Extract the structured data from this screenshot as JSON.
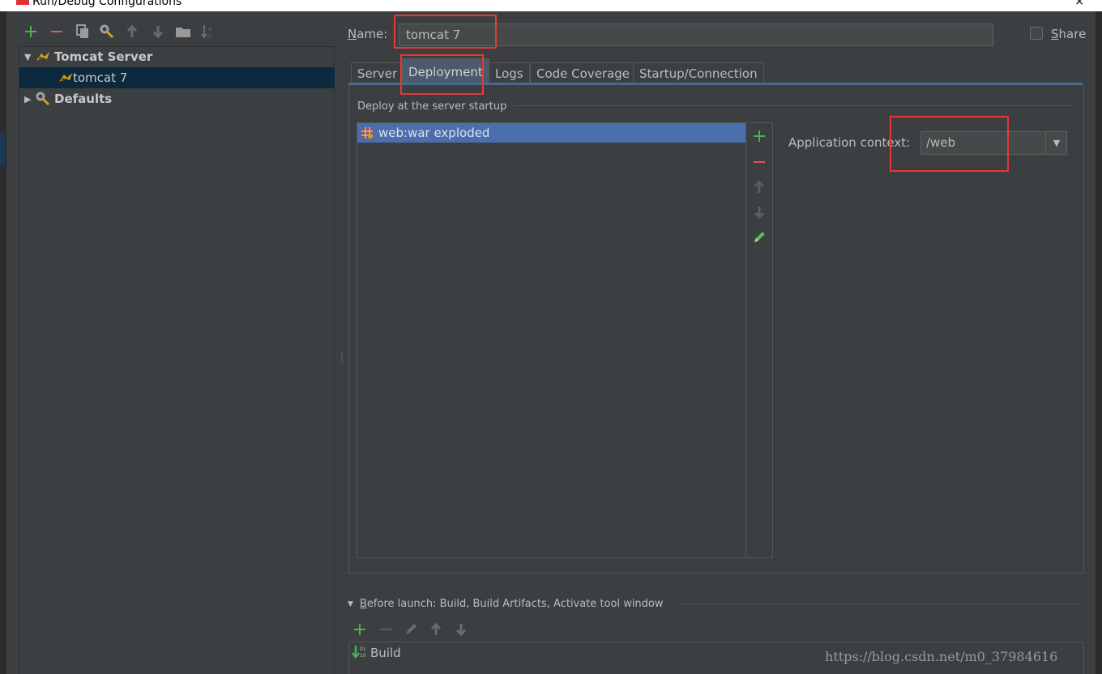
{
  "window": {
    "title": "Run/Debug Configurations",
    "close_glyph": "×"
  },
  "toolbar": {
    "icons": [
      "plus-icon",
      "minus-icon",
      "copy-icon",
      "wrench-icon",
      "arrow-up-icon",
      "arrow-down-icon",
      "folder-icon",
      "sort-icon"
    ]
  },
  "tree": {
    "group": {
      "label": "Tomcat Server",
      "expanded": true,
      "icon": "tomcat-icon"
    },
    "child": {
      "label": "tomcat 7",
      "selected": true,
      "icon": "tomcat-icon"
    },
    "defaults": {
      "label": "Defaults",
      "expanded": false,
      "icon": "wrench-icon"
    }
  },
  "form": {
    "name_label_prefix": "N",
    "name_label_rest": "ame:",
    "name_value": "tomcat 7",
    "share_label_prefix": "S",
    "share_label_rest": "hare",
    "share_checked": false
  },
  "tabs": [
    {
      "label": "Server",
      "active": false
    },
    {
      "label": "Deployment",
      "active": true
    },
    {
      "label": "Logs",
      "active": false
    },
    {
      "label": "Code Coverage",
      "active": false
    },
    {
      "label": "Startup/Connection",
      "active": false
    }
  ],
  "deployment": {
    "section_title": "Deploy at the server startup",
    "artifacts": [
      {
        "label": "web:war exploded",
        "selected": true,
        "icon": "artifact-icon"
      }
    ],
    "list_tools": [
      "plus-icon",
      "minus-icon",
      "arrow-up-icon",
      "arrow-down-icon",
      "edit-pencil-icon"
    ],
    "context_label": "Application context:",
    "context_value": "/web"
  },
  "before_launch": {
    "label_prefix": "B",
    "label_rest": "efore launch: Build, Build Artifacts, Activate tool window",
    "tools": [
      "plus-icon",
      "minus-icon",
      "edit-pencil-icon",
      "arrow-up-icon",
      "arrow-down-icon"
    ],
    "items": [
      {
        "label": "Build",
        "icon": "build-icon"
      }
    ]
  },
  "watermark": "https://blog.csdn.net/m0_37984616",
  "colors": {
    "accent": "#4b6eaf",
    "annotation": "#e53935",
    "add": "#4caf50",
    "remove": "#e05555"
  }
}
